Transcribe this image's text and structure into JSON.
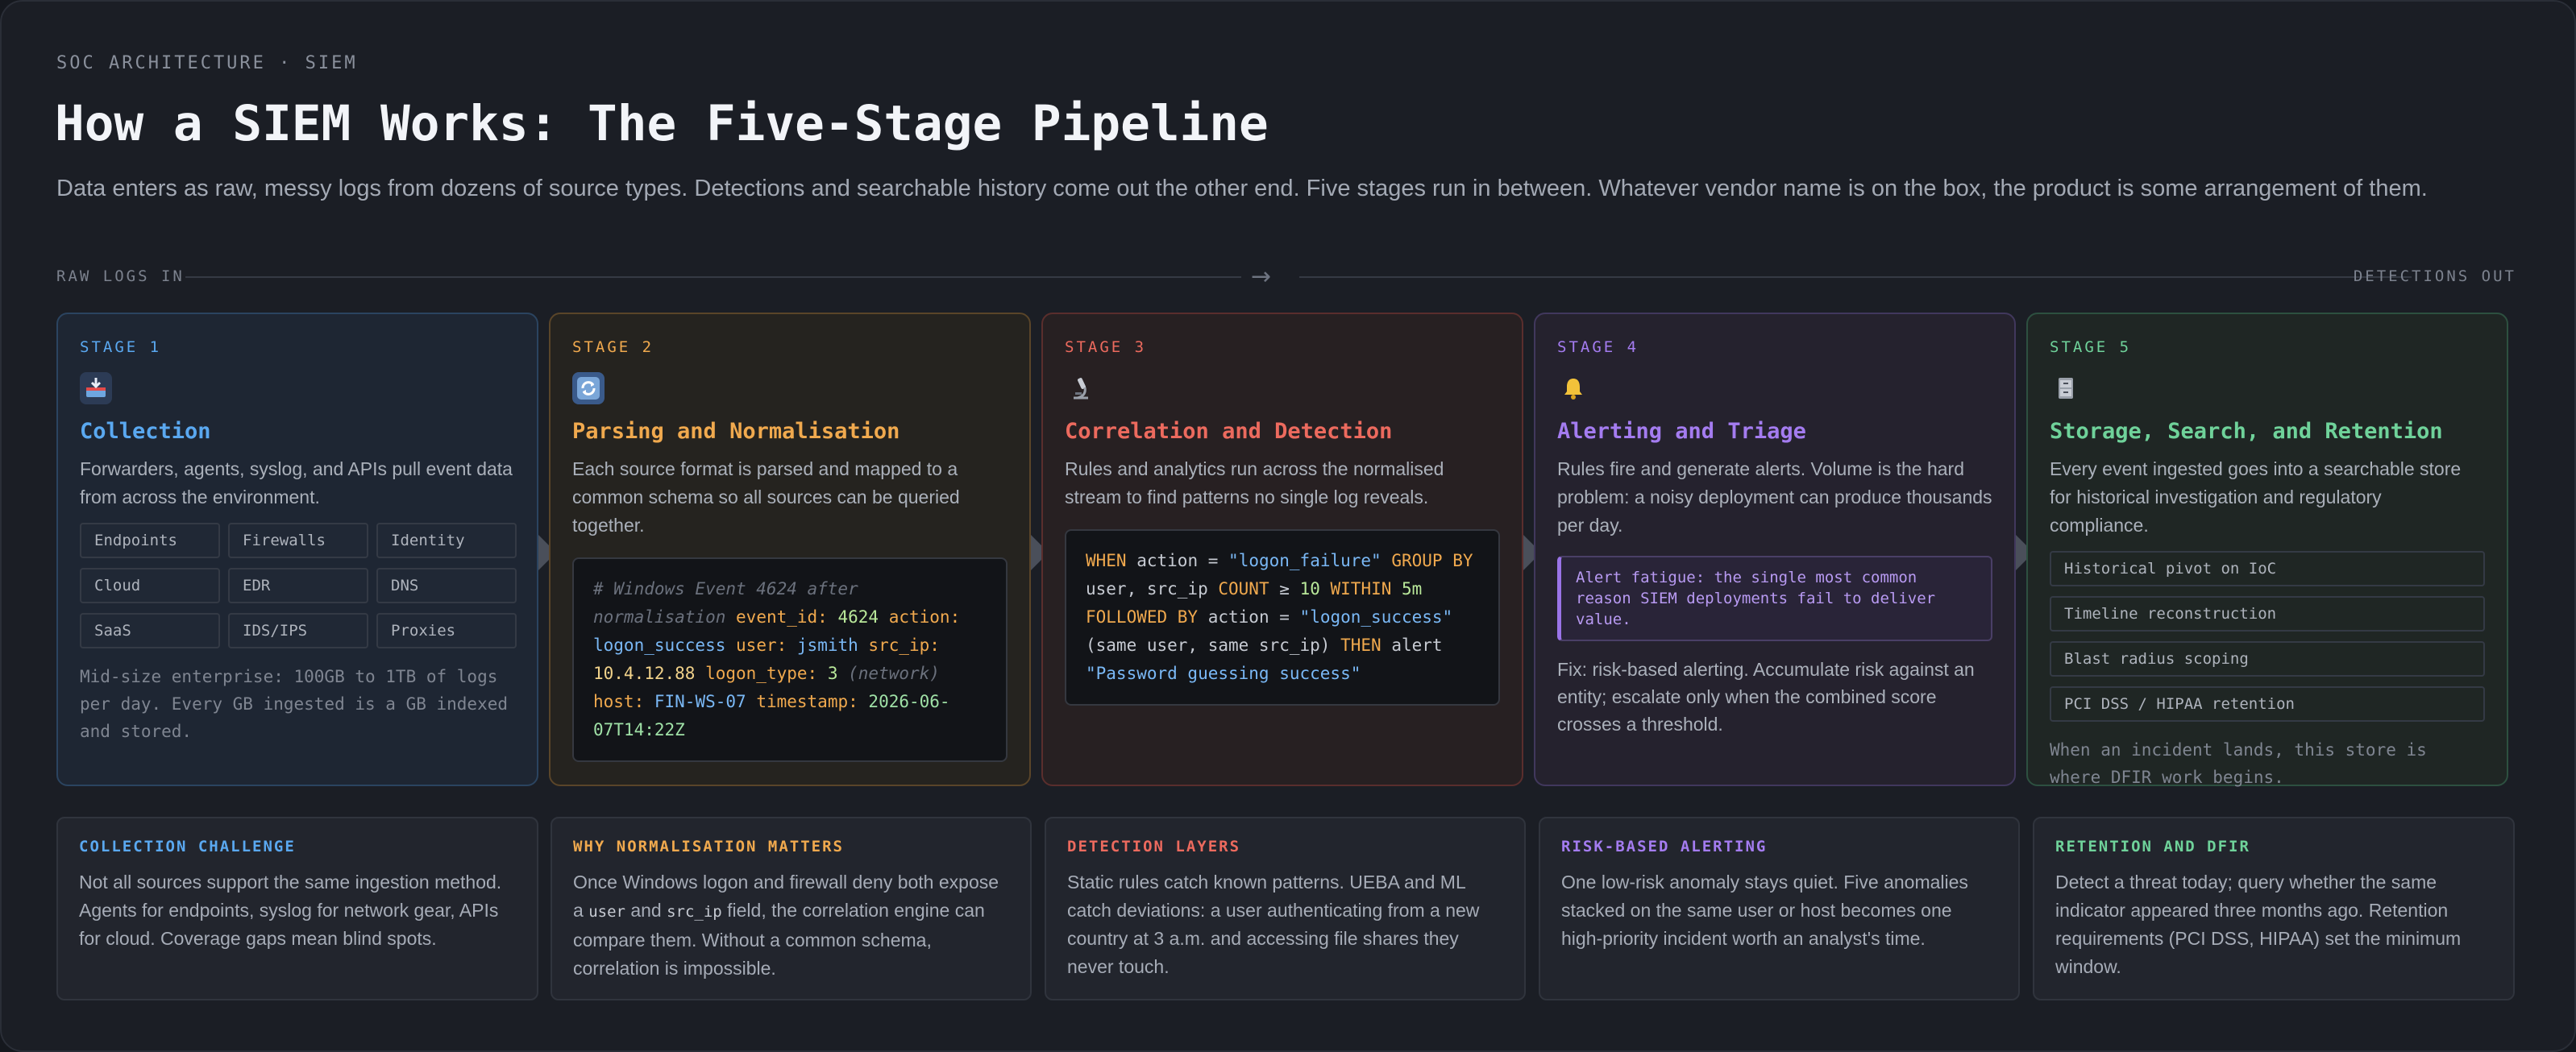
{
  "header": {
    "eyebrow": "SOC ARCHITECTURE · SIEM",
    "title": "How a SIEM Works: The Five-Stage Pipeline",
    "subtitle": "Data enters as raw, messy logs from dozens of source types. Detections and searchable history come out the other end. Five stages run in between. Whatever vendor name is on the box, the product is some arrangement of them."
  },
  "flow": {
    "left_label": "RAW LOGS IN",
    "right_label": "DETECTIONS OUT",
    "arrow": "→"
  },
  "colors": {
    "stage1": "#5aa8f0",
    "stage2": "#f0a94e",
    "stage3": "#ec6a5e",
    "stage4": "#a47cf0",
    "stage5": "#6fd29a"
  },
  "stages": [
    {
      "label": "STAGE 1",
      "icon": "inbox-tray-icon",
      "title": "Collection",
      "desc": "Forwarders, agents, syslog, and APIs pull event data from across the environment.",
      "sources": [
        "Endpoints",
        "Firewalls",
        "Identity",
        "Cloud",
        "EDR",
        "DNS",
        "SaaS",
        "IDS/IPS",
        "Proxies"
      ],
      "note": "Mid-size enterprise: 100GB to 1TB of logs per day. Every GB ingested is a GB indexed and stored."
    },
    {
      "label": "STAGE 2",
      "icon": "refresh-icon",
      "title": "Parsing and Normalisation",
      "desc": "Each source format is parsed and mapped to a common schema so all sources can be queried together.",
      "code": {
        "comment": "# Windows Event 4624 after normalisation",
        "k1": "event_id:",
        "v1": "4624",
        "k2": "action:",
        "v2": "logon_success",
        "k3": "user:",
        "v3": "jsmith",
        "k4": "src_ip:",
        "v4": "10.4.12.88",
        "k5": "logon_type:",
        "v5": "3",
        "c5": "(network)",
        "k6": "host:",
        "v6": "FIN-WS-07",
        "k7": "timestamp:",
        "v7": "2026-06-07T14:22Z"
      }
    },
    {
      "label": "STAGE 3",
      "icon": "microscope-icon",
      "title": "Correlation and Detection",
      "desc": "Rules and analytics run across the normalised stream to find patterns no single log reveals.",
      "code": {
        "when": "WHEN",
        "t1": "action =",
        "s1": "\"logon_failure\"",
        "group_by": "GROUP BY",
        "t2": "user, src_ip",
        "count": "COUNT",
        "t3": "≥",
        "n1": "10",
        "within": "WITHIN",
        "n2": "5m",
        "followed_by": "FOLLOWED BY",
        "t4": "action =",
        "s2": "\"logon_success\"",
        "t5": "(same user, same src_ip)",
        "then": "THEN",
        "t6": "alert",
        "s3": "\"Password guessing success\""
      }
    },
    {
      "label": "STAGE 4",
      "icon": "bell-icon",
      "title": "Alerting and Triage",
      "desc": "Rules fire and generate alerts. Volume is the hard problem: a noisy deployment can produce thousands per day.",
      "callout": "Alert fatigue: the single most common reason SIEM deployments fail to deliver value.",
      "fix": "Fix: risk-based alerting. Accumulate risk against an entity; escalate only when the combined score crosses a threshold."
    },
    {
      "label": "STAGE 5",
      "icon": "file-cabinet-icon",
      "title": "Storage, Search, and Retention",
      "desc": "Every event ingested goes into a searchable store for historical investigation and regulatory compliance.",
      "uses": [
        "Historical pivot on IoC",
        "Timeline reconstruction",
        "Blast radius scoping",
        "PCI DSS / HIPAA retention"
      ],
      "note": "When an incident lands, this store is where DFIR work begins."
    }
  ],
  "info_cards": [
    {
      "title": "COLLECTION CHALLENGE",
      "text": "Not all sources support the same ingestion method. Agents for endpoints, syslog for network gear, APIs for cloud. Coverage gaps mean blind spots."
    },
    {
      "title": "WHY NORMALISATION MATTERS",
      "text_a": "Once Windows logon and firewall deny both expose a",
      "code_a": "user",
      "text_b": "and",
      "code_b": "src_ip",
      "text_c": "field, the correlation engine can compare them. Without a common schema, correlation is impossible."
    },
    {
      "title": "DETECTION LAYERS",
      "text": "Static rules catch known patterns. UEBA and ML catch deviations: a user authenticating from a new country at 3 a.m. and accessing file shares they never touch."
    },
    {
      "title": "RISK-BASED ALERTING",
      "text": "One low-risk anomaly stays quiet. Five anomalies stacked on the same user or host becomes one high-priority incident worth an analyst's time."
    },
    {
      "title": "RETENTION AND DFIR",
      "text": "Detect a threat today; query whether the same indicator appeared three months ago. Retention requirements (PCI DSS, HIPAA) set the minimum window."
    }
  ]
}
